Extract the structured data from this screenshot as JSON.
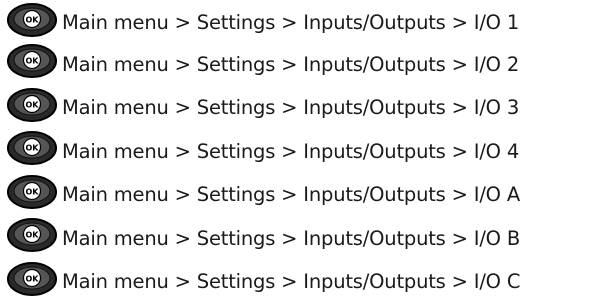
{
  "ok_button": {
    "icon": "ok-button-icon",
    "label": "OK",
    "fill": "#2a2a2a",
    "rim": "#000000",
    "face": "#ffffff"
  },
  "separator": ">",
  "paths": [
    {
      "crumbs": [
        "Main menu",
        "Settings",
        "Inputs/Outputs",
        "I/O 1"
      ],
      "text": "Main menu > Settings > Inputs/Outputs > I/O 1"
    },
    {
      "crumbs": [
        "Main menu",
        "Settings",
        "Inputs/Outputs",
        "I/O 2"
      ],
      "text": "Main menu > Settings > Inputs/Outputs > I/O 2"
    },
    {
      "crumbs": [
        "Main menu",
        "Settings",
        "Inputs/Outputs",
        "I/O 3"
      ],
      "text": "Main menu > Settings > Inputs/Outputs > I/O 3"
    },
    {
      "crumbs": [
        "Main menu",
        "Settings",
        "Inputs/Outputs",
        "I/O 4"
      ],
      "text": "Main menu > Settings > Inputs/Outputs > I/O 4"
    },
    {
      "crumbs": [
        "Main menu",
        "Settings",
        "Inputs/Outputs",
        "I/O A"
      ],
      "text": "Main menu > Settings > Inputs/Outputs > I/O A"
    },
    {
      "crumbs": [
        "Main menu",
        "Settings",
        "Inputs/Outputs",
        "I/O B"
      ],
      "text": "Main menu > Settings > Inputs/Outputs > I/O B"
    },
    {
      "crumbs": [
        "Main menu",
        "Settings",
        "Inputs/Outputs",
        "I/O C"
      ],
      "text": "Main menu > Settings > Inputs/Outputs > I/O C"
    }
  ]
}
